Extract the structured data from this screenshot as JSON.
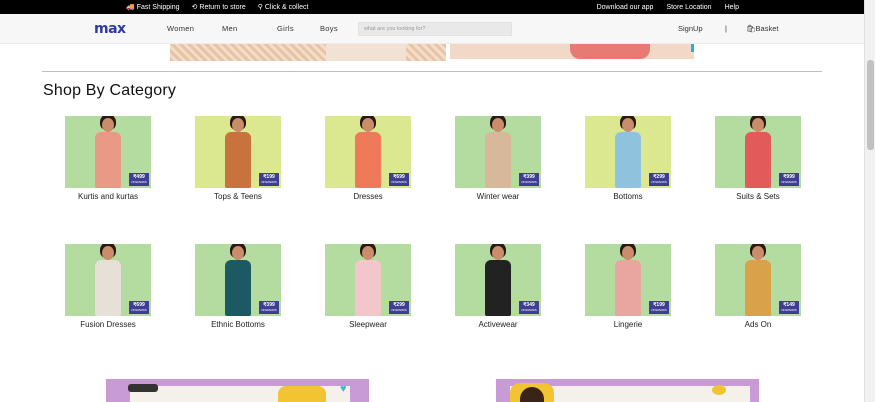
{
  "utility_bar": {
    "left": [
      {
        "icon": "truck-icon",
        "label": "Fast Shipping"
      },
      {
        "icon": "return-icon",
        "label": "Return to store"
      },
      {
        "icon": "person-icon",
        "label": "Click & collect"
      }
    ],
    "right": [
      "Download our app",
      "Store Location",
      "Help"
    ]
  },
  "nav": {
    "logo": "max",
    "links": [
      "Women",
      "Men",
      "Girls",
      "Boys"
    ],
    "search_placeholder": "what are you looking for?",
    "signup": "SignUp",
    "separator": "|",
    "basket": "Basket"
  },
  "section": {
    "title": "Shop By Category",
    "categories": [
      {
        "label": "Kurtis and kurtas",
        "price": "499",
        "bg": "#b4dca0"
      },
      {
        "label": "Tops & Teens",
        "price": "199",
        "bg": "#dbe88f"
      },
      {
        "label": "Dresses",
        "price": "699",
        "bg": "#dbe88f"
      },
      {
        "label": "Winter wear",
        "price": "399",
        "bg": "#b4dca0"
      },
      {
        "label": "Bottoms",
        "price": "299",
        "bg": "#dbe88f"
      },
      {
        "label": "Suits & Sets",
        "price": "999",
        "bg": "#b4dca0"
      },
      {
        "label": "Fusion Dresses",
        "price": "699",
        "bg": "#b4dca0"
      },
      {
        "label": "Ethnic Bottoms",
        "price": "399",
        "bg": "#b4dca0"
      },
      {
        "label": "Sleepwear",
        "price": "299",
        "bg": "#b4dca0"
      },
      {
        "label": "Activewear",
        "price": "349",
        "bg": "#b4dca0"
      },
      {
        "label": "Lingerie",
        "price": "199",
        "bg": "#b4dca0"
      },
      {
        "label": "Ads On",
        "price": "149",
        "bg": "#b4dca0"
      }
    ],
    "price_prefix": "₹",
    "price_subtext": "ONWARDS"
  },
  "colors": {
    "brand": "#2f3aa7",
    "price_badge": "#3e3f93",
    "utility_bar": "#000000"
  }
}
